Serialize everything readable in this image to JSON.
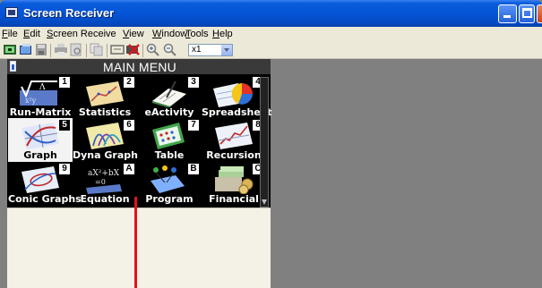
{
  "window": {
    "title": "Screen Receiver",
    "buttons": [
      "minimize",
      "maximize",
      "close"
    ]
  },
  "menu": [
    {
      "label": "File",
      "underline": "F",
      "rest": "ile"
    },
    {
      "label": "Edit",
      "underline": "E",
      "rest": "dit"
    },
    {
      "label": "Screen Receive",
      "underline": "S",
      "rest": "creen Receive"
    },
    {
      "label": "View",
      "underline": "V",
      "rest": "iew"
    },
    {
      "label": "Window",
      "underline": "W",
      "rest": "indow"
    },
    {
      "label": "Tools",
      "underline": "T",
      "rest": "ools"
    },
    {
      "label": "Help",
      "underline": "H",
      "rest": "elp"
    }
  ],
  "toolbar": {
    "icons": [
      "capture-icon",
      "open-icon",
      "save-icon",
      "print-icon",
      "print-preview-icon",
      "copy-icon",
      "fit-screen-icon",
      "stop-capture-icon",
      "zoom-in-icon",
      "zoom-out-icon"
    ],
    "zoom_value": "x1"
  },
  "calculator": {
    "menu_title": "MAIN MENU",
    "selected": "5",
    "tiles": [
      {
        "num": "1",
        "label": "Run-Matrix"
      },
      {
        "num": "2",
        "label": "Statistics"
      },
      {
        "num": "3",
        "label": "eActivity"
      },
      {
        "num": "4",
        "label": "Spreadsheet"
      },
      {
        "num": "5",
        "label": "Graph"
      },
      {
        "num": "6",
        "label": "Dyna Graph"
      },
      {
        "num": "7",
        "label": "Table"
      },
      {
        "num": "8",
        "label": "Recursion"
      },
      {
        "num": "9",
        "label": "Conic Graphs"
      },
      {
        "num": "A",
        "label": "Equation"
      },
      {
        "num": "B",
        "label": "Program"
      },
      {
        "num": "C",
        "label": "Financial"
      }
    ]
  }
}
